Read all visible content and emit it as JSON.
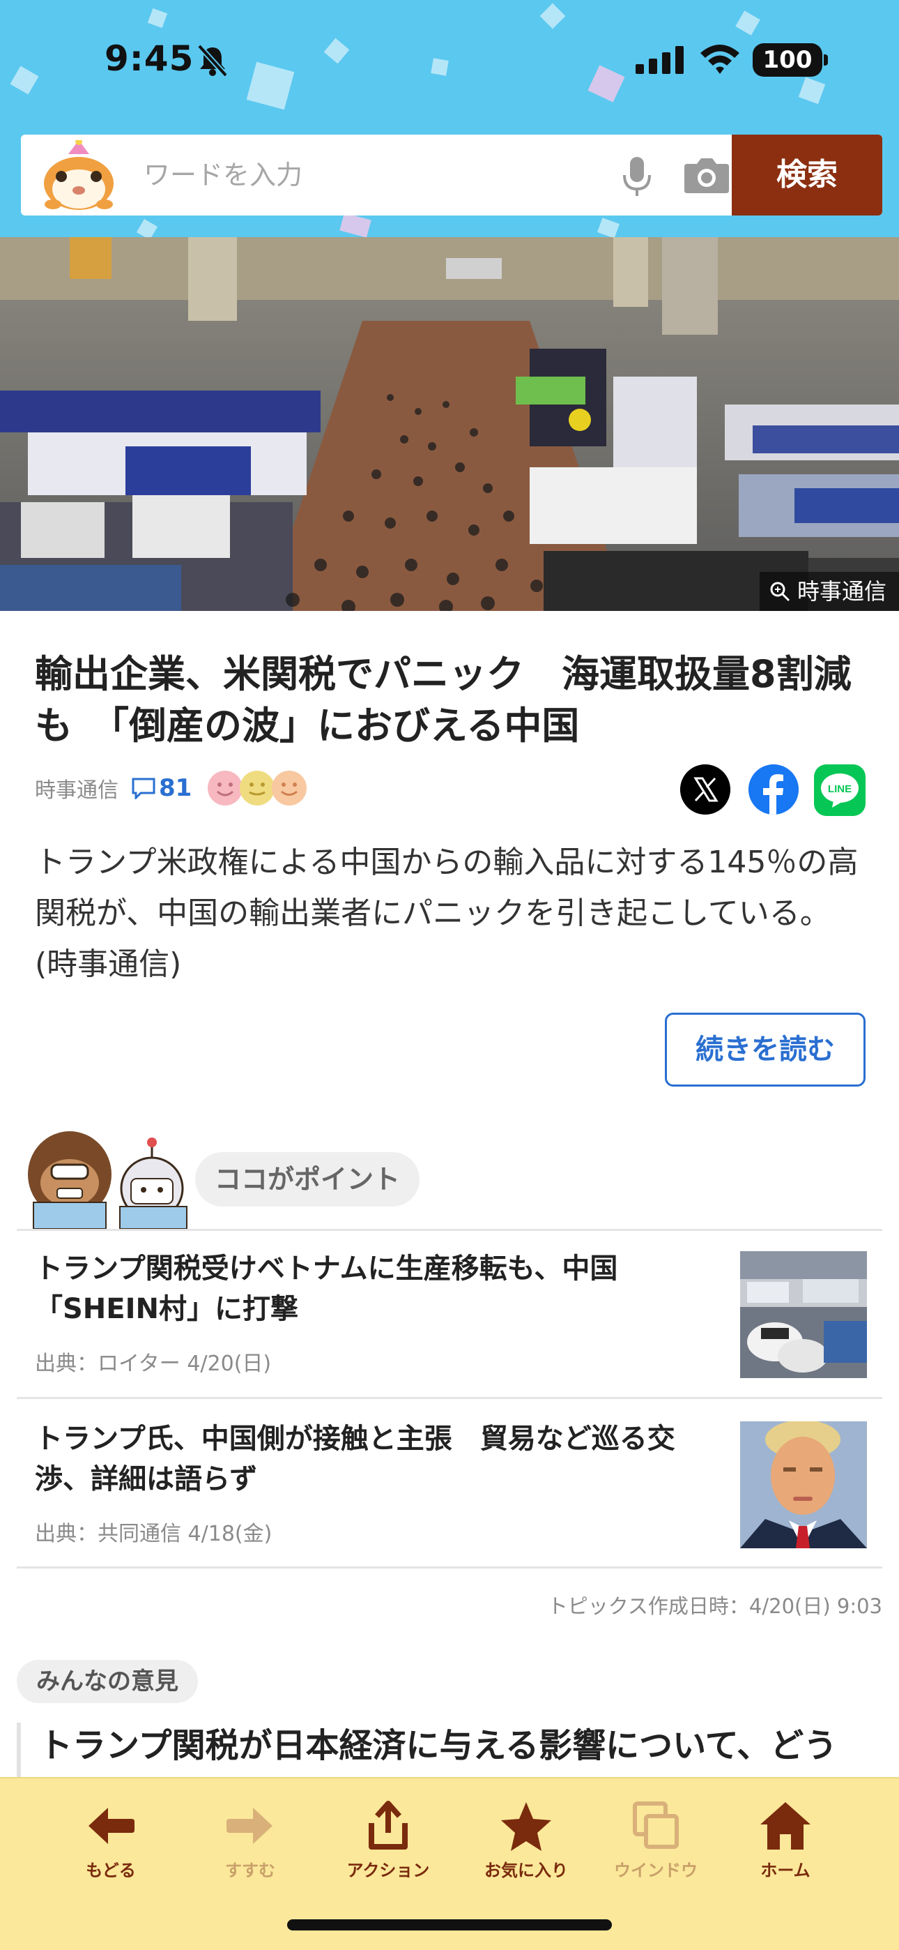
{
  "status_bar": {
    "time": "9:45",
    "battery": "100"
  },
  "search": {
    "placeholder": "ワードを入力",
    "button_label": "検索"
  },
  "hero": {
    "credit": "時事通信"
  },
  "article": {
    "title": "輸出企業、米関税でパニック　海運取扱量8割減も　「倒産の波」におびえる中国",
    "source": "時事通信",
    "comment_count": "81",
    "summary": "トランプ米政権による中国からの輸入品に対する145％の高関税が、中国の輸出業者にパニックを引き起こしている。(時事通信)",
    "read_more_label": "続きを読む"
  },
  "points": {
    "label": "ココがポイント",
    "items": [
      {
        "title": "トランプ関税受けベトナムに生産移転も、中国「SHEIN村」に打撃",
        "meta": "出典：ロイター  4/20(日)"
      },
      {
        "title": "トランプ氏、中国側が接触と主張　貿易など巡る交渉、詳細は語らず",
        "meta": "出典：共同通信  4/18(金)"
      }
    ],
    "created": "トピックス作成日時：4/20(日) 9:03"
  },
  "opinion": {
    "label": "みんなの意見",
    "question": "トランプ関税が日本経済に与える影響について、どう"
  },
  "toolbar": {
    "back": "もどる",
    "forward": "すすむ",
    "action": "アクション",
    "favorites": "お気に入り",
    "window": "ウインドウ",
    "home": "ホーム"
  },
  "colors": {
    "header_bg": "#5bc8ef",
    "search_button": "#8b2f10",
    "link_blue": "#2a6fd1",
    "toolbar_bg": "#fbe89a",
    "toolbar_active": "#7a2a0d",
    "toolbar_dim": "#c9a06a"
  }
}
